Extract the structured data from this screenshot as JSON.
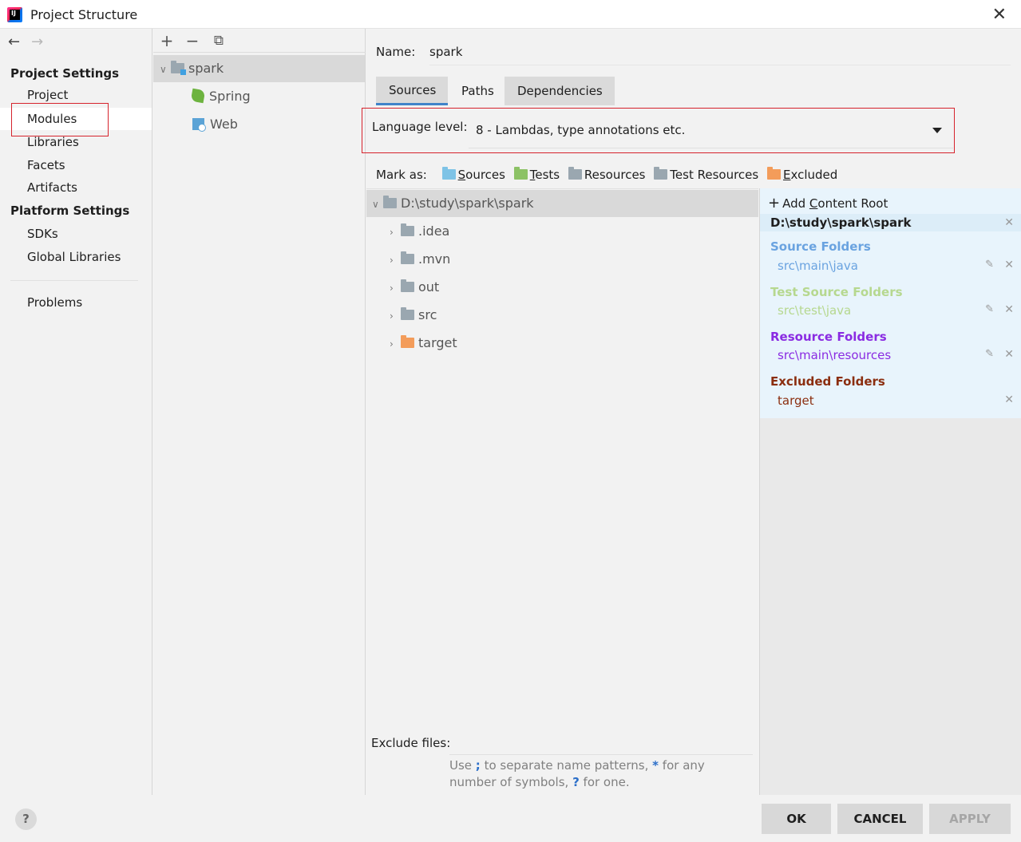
{
  "window": {
    "title": "Project Structure",
    "close": "✕"
  },
  "nav": {
    "back": "←",
    "forward": "→",
    "project_settings": "Project Settings",
    "items_project": [
      "Project",
      "Modules",
      "Libraries",
      "Facets",
      "Artifacts"
    ],
    "platform_settings": "Platform Settings",
    "items_platform": [
      "SDKs",
      "Global Libraries"
    ],
    "problems": "Problems",
    "selected": "Modules"
  },
  "module_tree": {
    "toolbar": {
      "add": "+",
      "remove": "−",
      "copy": "⧉"
    },
    "root": "spark",
    "children": [
      "Spring",
      "Web"
    ]
  },
  "module": {
    "name_label": "Name:",
    "name_value": "spark",
    "tabs": [
      "Sources",
      "Paths",
      "Dependencies"
    ],
    "active_tab": "Sources",
    "language_level_label": "Language level:",
    "language_level_value": "8 - Lambdas, type annotations etc.",
    "mark_as_label": "Mark as:",
    "mark_as": [
      "Sources",
      "Tests",
      "Resources",
      "Test Resources",
      "Excluded"
    ],
    "mark_as_first": [
      "S",
      "T",
      "R",
      "T",
      "E"
    ],
    "mark_as_rest": [
      "ources",
      "ests",
      "esources",
      "est Resources",
      "xcluded"
    ]
  },
  "content_tree": {
    "root": "D:\\study\\spark\\spark",
    "children": [
      ".idea",
      ".mvn",
      "out",
      "src",
      "target"
    ]
  },
  "content_roots": {
    "add_label": "Add Content Root",
    "add_pre": "Add ",
    "add_u": "C",
    "add_post": "ontent Root",
    "root": "D:\\study\\spark\\spark",
    "source_title": "Source Folders",
    "source_path": "src\\main\\java",
    "test_title": "Test Source Folders",
    "test_path": "src\\test\\java",
    "resource_title": "Resource Folders",
    "resource_path": "src\\main\\resources",
    "excluded_title": "Excluded Folders",
    "excluded_path": "target",
    "colors": {
      "source": "#6aa3e0",
      "test": "#b6d88f",
      "resource": "#8a2be2",
      "excluded": "#8b2e0f"
    }
  },
  "exclude": {
    "label": "Exclude files:",
    "hint_1": "Use ",
    "hint_semicolon": ";",
    "hint_2": " to separate name patterns, ",
    "hint_star": "*",
    "hint_3": " for any number of symbols, ",
    "hint_q": "?",
    "hint_4": " for one."
  },
  "footer": {
    "help": "?",
    "ok": "OK",
    "cancel": "CANCEL",
    "apply": "APPLY"
  }
}
